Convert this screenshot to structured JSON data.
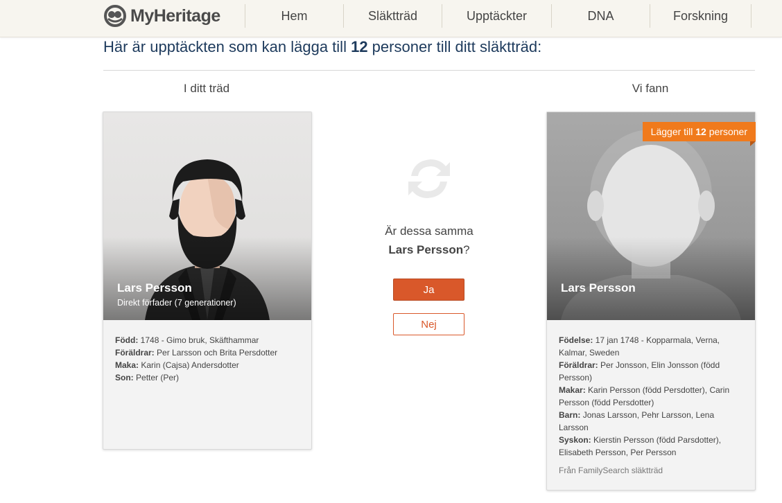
{
  "header": {
    "logo_text": "MyHeritage",
    "nav": [
      "Hem",
      "Släktträd",
      "Upptäckter",
      "DNA",
      "Forskning"
    ]
  },
  "headline": {
    "prefix": "Här är upptäckten som kan lägga till ",
    "count": "12",
    "suffix": " personer till ditt släktträd:"
  },
  "columns": {
    "left_title": "I ditt träd",
    "right_title": "Vi fann"
  },
  "left_card": {
    "name": "Lars Persson",
    "subtitle": "Direkt förfader (7 generationer)",
    "details": [
      {
        "label": "Född:",
        "value": "1748 - Gimo bruk, Skäfthammar"
      },
      {
        "label": "Föräldrar:",
        "value": "Per Larsson och Brita Persdotter"
      },
      {
        "label": "Maka:",
        "value": "Karin (Cajsa) Andersdotter"
      },
      {
        "label": "Son:",
        "value": "Petter (Per)"
      }
    ]
  },
  "middle": {
    "question_line1": "Är dessa samma",
    "question_name": "Lars Persson",
    "question_mark": "?",
    "yes_label": "Ja",
    "no_label": "Nej"
  },
  "right_card": {
    "name": "Lars Persson",
    "badge_prefix": "Lägger till ",
    "badge_count": "12",
    "badge_suffix": " personer",
    "details": [
      {
        "label": "Födelse:",
        "value": "17 jan 1748 - Kopparmala, Verna, Kalmar, Sweden"
      },
      {
        "label": "Föräldrar:",
        "value": "Per Jonsson, Elin Jonsson (född Persson)"
      },
      {
        "label": "Makar:",
        "value": "Karin Persson (född Persdotter), Carin Persson (född Persdotter)"
      },
      {
        "label": "Barn:",
        "value": "Jonas Larsson, Pehr Larsson, Lena Larsson"
      },
      {
        "label": "Syskon:",
        "value": "Kierstin Persson (född Parsdotter), Elisabeth Persson, Per Persson"
      }
    ],
    "source": "Från FamilySearch släktträd"
  },
  "colors": {
    "brand_orange": "#d9582a",
    "badge_orange": "#f07a1c",
    "headline_blue": "#1d3a5c"
  }
}
